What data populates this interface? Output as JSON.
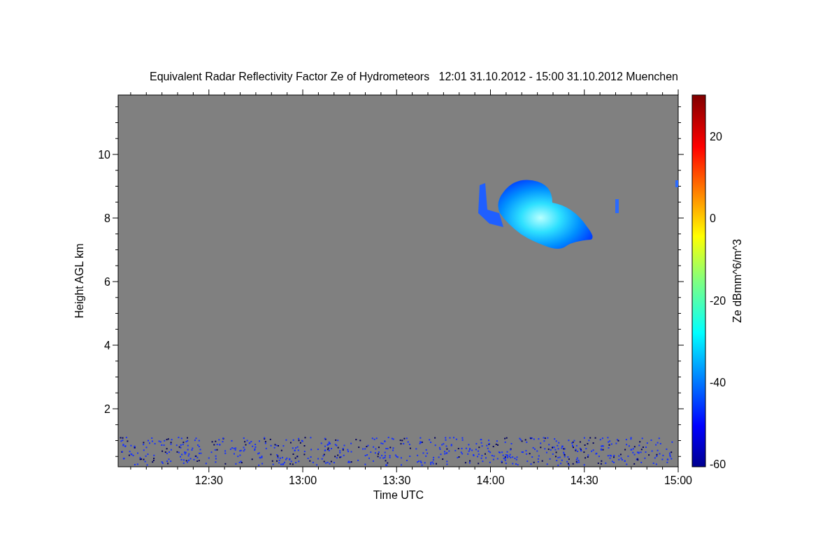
{
  "chart": {
    "title": "Equivalent Radar Reflectivity Factor Ze of Hydrometeors   12:01 31.10.2012 - 15:00 31.10.2012 Muenchen",
    "xlabel": "Time UTC",
    "ylabel": "Height AGL km",
    "xticks": [
      "12:30",
      "13:00",
      "13:30",
      "14:00",
      "14:30",
      "15:00"
    ],
    "yticks": [
      "10",
      "8",
      "6",
      "4",
      "2"
    ]
  },
  "colorbar": {
    "label": "Ze dBmm^6/m^3",
    "ticks": [
      "20",
      "0",
      "-20",
      "-40",
      "-60"
    ]
  }
}
